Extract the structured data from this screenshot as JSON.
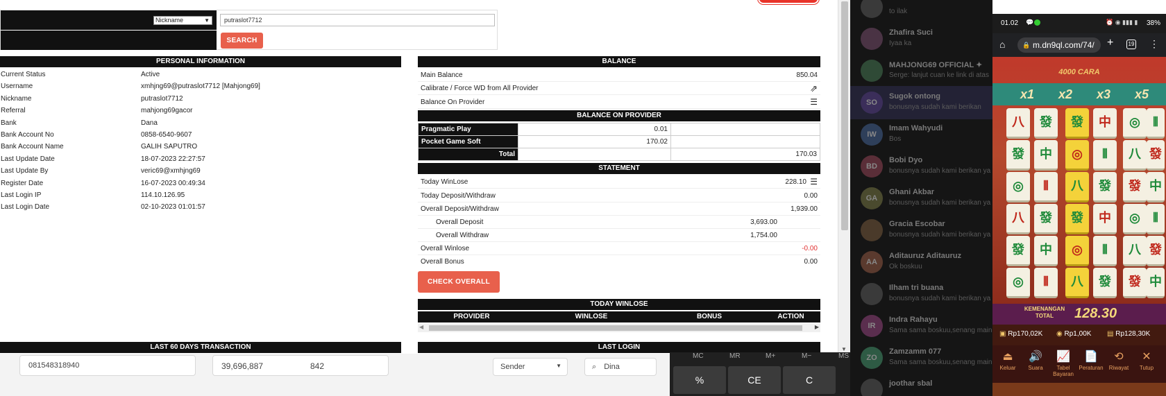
{
  "search": {
    "field_select": "Nickname",
    "query": "putraslot7712",
    "button": "SEARCH"
  },
  "personal": {
    "title": "PERSONAL INFORMATION",
    "rows": [
      {
        "label": "Current Status",
        "value": "Active"
      },
      {
        "label": "Username",
        "value": "xmhjng69@putraslot7712  [Mahjong69]"
      },
      {
        "label": "Nickname",
        "value": "putraslot7712"
      },
      {
        "label": "Referral",
        "value": "mahjong69gacor"
      },
      {
        "label": "Bank",
        "value": "Dana"
      },
      {
        "label": "Bank Account No",
        "value": "0858-6540-9607"
      },
      {
        "label": "Bank Account Name",
        "value": "GALIH SAPUTRO"
      },
      {
        "label": "Last Update Date",
        "value": "18-07-2023 22:27:57"
      },
      {
        "label": "Last Update By",
        "value": "veric69@xmhjng69"
      },
      {
        "label": "Register Date",
        "value": "16-07-2023 00:49:34"
      },
      {
        "label": "Last Login IP",
        "value": "114.10.126.95"
      },
      {
        "label": "Last Login Date",
        "value": "02-10-2023 01:01:57"
      }
    ]
  },
  "balance": {
    "title": "BALANCE",
    "main_label": "Main Balance",
    "main_value": "850.04",
    "calibrate_label": "Calibrate / Force WD from All Provider",
    "on_provider_label": "Balance On Provider"
  },
  "provider": {
    "title": "BALANCE ON PROVIDER",
    "rows": [
      {
        "name": "Pragmatic Play",
        "value": "0.01"
      },
      {
        "name": "Pocket Game Soft",
        "value": "170.02"
      }
    ],
    "total_label": "Total",
    "total_value": "170.03"
  },
  "statement": {
    "title": "STATEMENT",
    "today_winlose_label": "Today WinLose",
    "today_winlose_value": "228.10",
    "today_dw_label": "Today Deposit/Withdraw",
    "today_dw_value": "0.00",
    "overall_dw_label": "Overall Deposit/Withdraw",
    "overall_dw_value": "1,939.00",
    "overall_deposit_label": "Overall Deposit",
    "overall_deposit_value": "3,693.00",
    "overall_withdraw_label": "Overall Withdraw",
    "overall_withdraw_value": "1,754.00",
    "overall_winlose_label": "Overall Winlose",
    "overall_winlose_value": "-0.00",
    "overall_bonus_label": "Overall Bonus",
    "overall_bonus_value": "0.00",
    "check_button": "CHECK OVERALL"
  },
  "today_winlose": {
    "title": "TODAY WINLOSE",
    "columns": [
      "PROVIDER",
      "WINLOSE",
      "BONUS",
      "ACTION"
    ]
  },
  "last60_title": "LAST 60 DAYS TRANSACTION",
  "last_login_title": "LAST LOGIN",
  "bg_app": {
    "phone_field": "081548318940",
    "amount": "39,696,887",
    "count": "842",
    "sender_select": "Sender",
    "search_value": "Dina"
  },
  "calculator": {
    "memory_keys": [
      "MC",
      "MR",
      "M+",
      "M−",
      "MS"
    ],
    "keys": [
      "%",
      "CE",
      "C"
    ]
  },
  "chat": [
    {
      "initials": "",
      "name": "",
      "msg": "to ilak"
    },
    {
      "initials": "",
      "name": "Zhafira Suci",
      "msg": "Iyaa ka"
    },
    {
      "initials": "",
      "name": "MAHJONG69 OFFICIAL ✦",
      "msg": "Serge: lanjut cuan ke link di atas"
    },
    {
      "initials": "SO",
      "name": "Sugok ontong",
      "msg": "bonusnya sudah kami berikan"
    },
    {
      "initials": "IW",
      "name": "Imam Wahyudi",
      "msg": "Bos"
    },
    {
      "initials": "BD",
      "name": "Bobi Dyo",
      "msg": "bonusnya sudah kami berikan ya"
    },
    {
      "initials": "GA",
      "name": "Ghani Akbar",
      "msg": "bonusnya sudah kami berikan ya"
    },
    {
      "initials": "",
      "name": "Gracia Escobar",
      "msg": "bonusnya sudah kami berikan ya"
    },
    {
      "initials": "AA",
      "name": "Aditauruz Aditauruz",
      "msg": "Ok boskuu"
    },
    {
      "initials": "",
      "name": "Ilham tri buana",
      "msg": "bonusnya sudah kami berikan ya"
    },
    {
      "initials": "IR",
      "name": "Indra Rahayu",
      "msg": "Sama sama boskuu,senang main"
    },
    {
      "initials": "ZO",
      "name": "Zamzamm 077",
      "msg": "Sama sama boskuu,senang main"
    },
    {
      "initials": "",
      "name": "joothar sbal",
      "msg": ""
    }
  ],
  "phone": {
    "time": "01.02",
    "battery": "38%",
    "url": "m.dn9ql.com/74/",
    "tabs": "19",
    "game_title": "4000 CARA",
    "multipliers": [
      "x1",
      "x2",
      "x3",
      "x5"
    ],
    "win_label": "KEMENANGAN TOTAL",
    "win_value": "128.30",
    "balance": "Rp170,02K",
    "bet": "Rp1,00K",
    "win_rp": "Rp128,30K",
    "bottom": [
      "Keluar",
      "Suara",
      "Tabel Bayaran",
      "Peraturan",
      "Riwayat",
      "Tutup"
    ]
  }
}
